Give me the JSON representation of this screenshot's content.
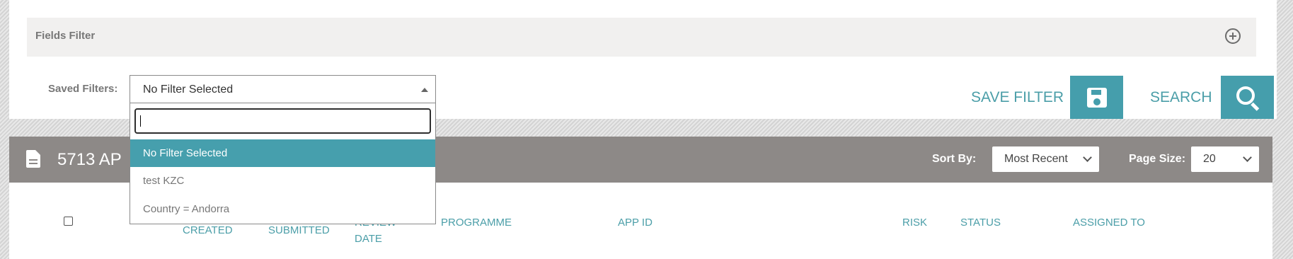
{
  "fields_filter": {
    "title": "Fields Filter",
    "icon": "plus-circle-icon"
  },
  "saved_filters": {
    "label": "Saved Filters:",
    "selected": "No Filter Selected",
    "search_value": "",
    "options": [
      "No Filter Selected",
      "test KZC",
      "Country = Andorra"
    ]
  },
  "actions": {
    "save_filter_label": "SAVE FILTER",
    "save_icon": "floppy-disk-icon",
    "search_label": "SEARCH",
    "search_icon": "magnifier-icon"
  },
  "results": {
    "count_text": "5713 AP",
    "icon": "document-icon",
    "sort_label": "Sort By:",
    "sort_value": "Most Recent",
    "page_size_label": "Page Size:",
    "page_size_value": "20"
  },
  "table": {
    "columns": {
      "created": "CREATED",
      "submitted": "SUBMITTED",
      "review_date_line1": "REVIEW",
      "review_date_line2": "DATE",
      "programme": "PROGRAMME",
      "app_id": "APP ID",
      "risk": "RISK",
      "status": "STATUS",
      "assigned_to": "ASSIGNED TO"
    }
  },
  "colors": {
    "accent": "#459eac",
    "results_bar": "#8d8987",
    "filter_bg": "#f1f0ef",
    "selected_option": "#469fad"
  }
}
